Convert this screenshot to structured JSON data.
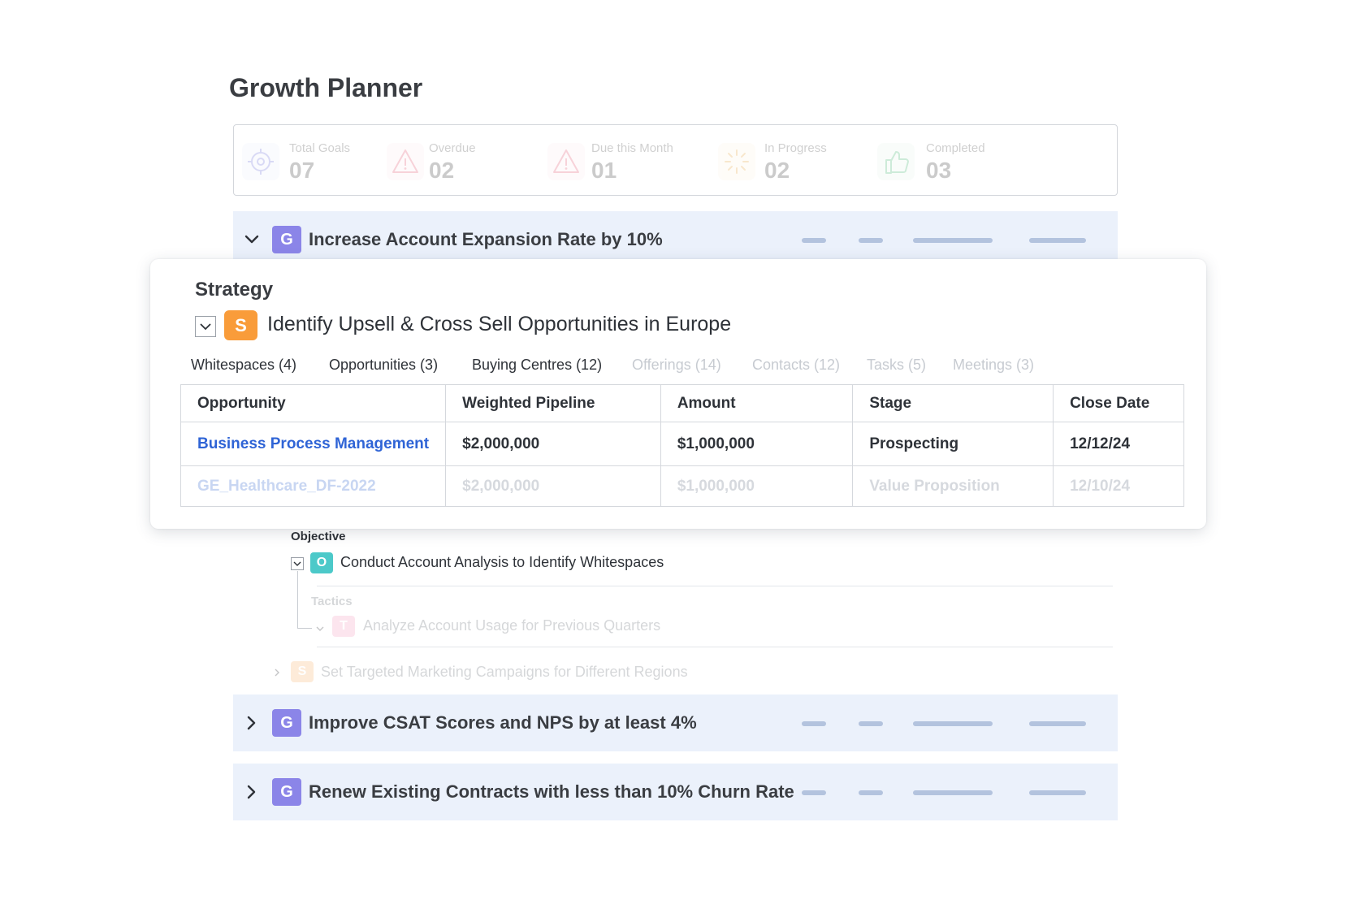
{
  "page": {
    "title": "Growth Planner"
  },
  "stats": [
    {
      "label": "Total Goals",
      "value": "07",
      "icon": "target-icon",
      "color": "#6b6fd8"
    },
    {
      "label": "Overdue",
      "value": "02",
      "icon": "warning-icon",
      "color": "#e0506a"
    },
    {
      "label": "Due this Month",
      "value": "01",
      "icon": "warning-icon",
      "color": "#e0506a"
    },
    {
      "label": "In Progress",
      "value": "02",
      "icon": "spinner-icon",
      "color": "#e6a23c"
    },
    {
      "label": "Completed",
      "value": "03",
      "icon": "thumbs-up-icon",
      "color": "#3bb26b"
    }
  ],
  "goals": [
    {
      "badge": "G",
      "title": "Increase Account Expansion Rate by 10%",
      "expanded": true
    },
    {
      "badge": "G",
      "title": "Improve CSAT Scores and NPS by at least 4%",
      "expanded": false
    },
    {
      "badge": "G",
      "title": "Renew Existing Contracts with less than 10% Churn Rate",
      "expanded": false
    }
  ],
  "strategy": {
    "label": "Strategy",
    "badge": "S",
    "title": "Identify Upsell & Cross Sell Opportunities in Europe",
    "tabs": [
      {
        "label": "Whitespaces (4)",
        "active": true
      },
      {
        "label": "Opportunities (3)",
        "active": true
      },
      {
        "label": "Buying Centres (12)",
        "active": true
      },
      {
        "label": "Offerings (14)",
        "active": false
      },
      {
        "label": "Contacts (12)",
        "active": false
      },
      {
        "label": "Tasks (5)",
        "active": false
      },
      {
        "label": "Meetings (3)",
        "active": false
      }
    ],
    "table": {
      "columns": [
        "Opportunity",
        "Weighted Pipeline",
        "Amount",
        "Stage",
        "Close Date"
      ],
      "rows": [
        {
          "opportunity": "Business Process Management",
          "weighted": "$2,000,000",
          "amount": "$1,000,000",
          "stage": "Prospecting",
          "close": "12/12/24"
        },
        {
          "opportunity": "GE_Healthcare_DF-2022",
          "weighted": "$2,000,000",
          "amount": "$1,000,000",
          "stage": "Value Proposition",
          "close": "12/10/24"
        }
      ]
    }
  },
  "objective": {
    "label": "Objective",
    "badge": "O",
    "title": "Conduct Account Analysis to Identify Whitespaces"
  },
  "tactic": {
    "label": "Tactics",
    "badge": "T",
    "title": "Analyze Account Usage for Previous Quarters"
  },
  "strategy2": {
    "badge": "S",
    "title": "Set Targeted Marketing Campaigns for Different Regions"
  },
  "colors": {
    "goal_badge": "#8b85e8",
    "strategy_badge": "#f99c3a",
    "objective_badge": "#4cc9c9",
    "tactic_badge": "#f7a6c4",
    "link": "#2f64d6",
    "row_bg": "#ebf1fb"
  }
}
